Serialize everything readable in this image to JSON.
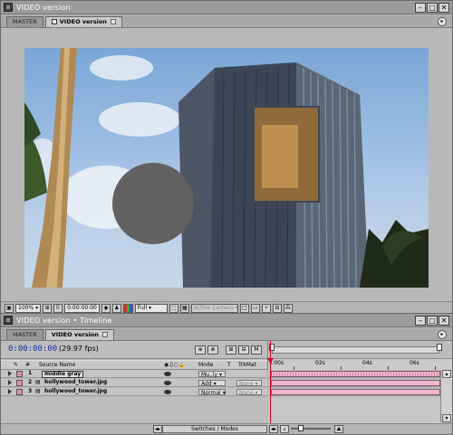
{
  "comp_window": {
    "title": "VIDEO version",
    "tabs": [
      {
        "label": "MASTER",
        "active": false
      },
      {
        "label": "VIDEO version",
        "active": true
      }
    ],
    "footer": {
      "zoom": "100%",
      "timecode": "0:00:00:00",
      "resolution": "Full",
      "active_camera": "Active Camera"
    },
    "viewer": {
      "layers_visible": [
        "middle gray",
        "hollywood_tower.jpg",
        "hollywood_tower.jpg"
      ]
    }
  },
  "timeline_window": {
    "title": "VIDEO version • Timeline",
    "tabs": [
      {
        "label": "MASTER",
        "active": false
      },
      {
        "label": "VIDEO version",
        "active": true
      }
    ],
    "timecode": "0:00:00:00",
    "fps": "(29.97 fps)",
    "columns": {
      "num": "#",
      "source_name": "Source Name",
      "mode": "Mode",
      "t": "T",
      "trkmat": "TrkMat"
    },
    "ruler_ticks": [
      "):00s",
      "02s",
      "04s",
      "06s"
    ],
    "layers": [
      {
        "number": "1",
        "name": "middle gray",
        "mode": "Mu..ly",
        "trkmat": "",
        "label_color": "#e58ab0",
        "selected": true
      },
      {
        "number": "2",
        "name": "hollywood_tower.jpg",
        "mode": "Add",
        "trkmat": "None",
        "label_color": "#e58ab0",
        "selected": false
      },
      {
        "number": "3",
        "name": "hollywood_tower.jpg",
        "mode": "Normal",
        "trkmat": "None",
        "label_color": "#e58ab0",
        "selected": false
      }
    ],
    "footer": {
      "switches_modes": "Switches / Modes"
    }
  },
  "colors": {
    "window_bg": "#b8b8b8",
    "timecode_blue": "#1a33a6",
    "layer_bar_pink": "#f0b6d0",
    "playhead_red": "#d8001c"
  }
}
